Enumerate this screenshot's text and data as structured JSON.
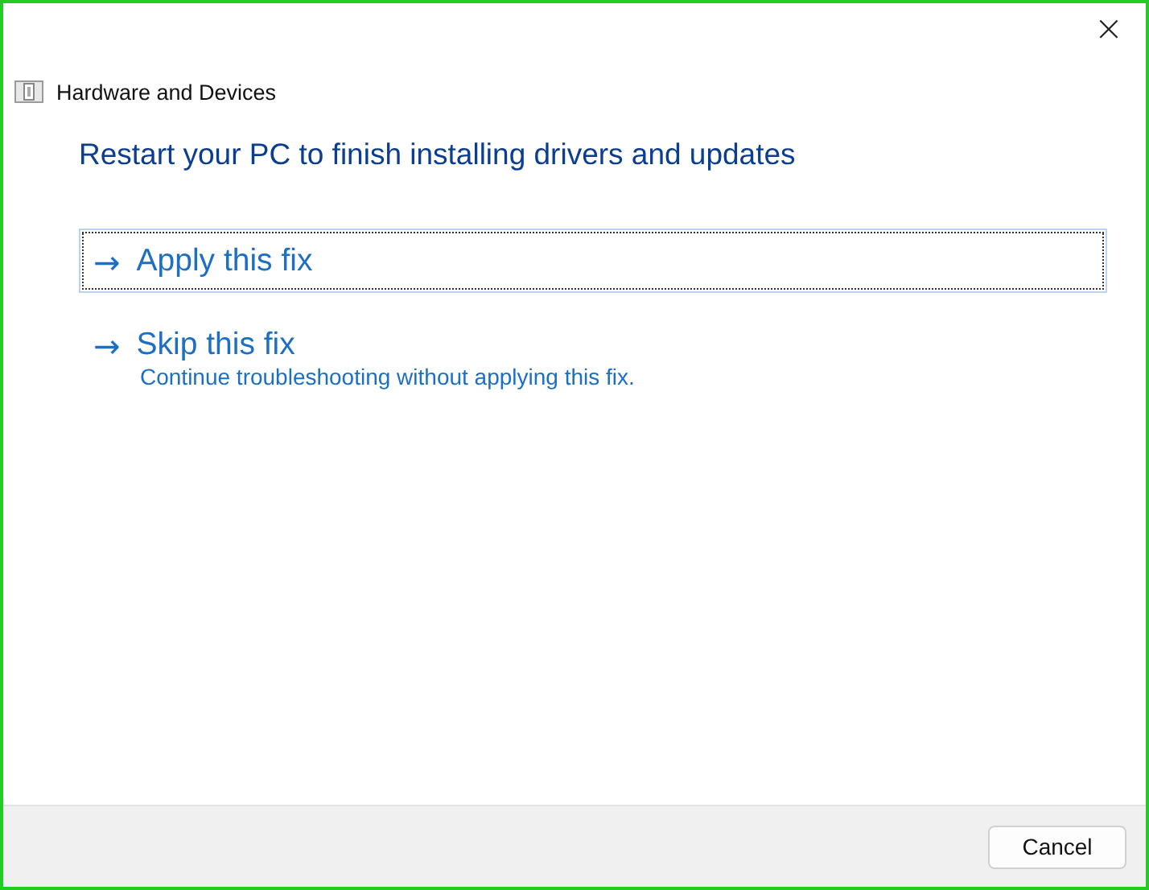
{
  "window": {
    "close_label": "×"
  },
  "header": {
    "title": "Hardware and Devices"
  },
  "heading": "Restart your PC to finish installing drivers and updates",
  "options": [
    {
      "arrow": "→",
      "label": "Apply this fix",
      "focused": true
    },
    {
      "arrow": "→",
      "label": "Skip this fix",
      "description": "Continue troubleshooting without applying this fix.",
      "focused": false
    }
  ],
  "footer": {
    "buttons": [
      "Cancel"
    ]
  }
}
